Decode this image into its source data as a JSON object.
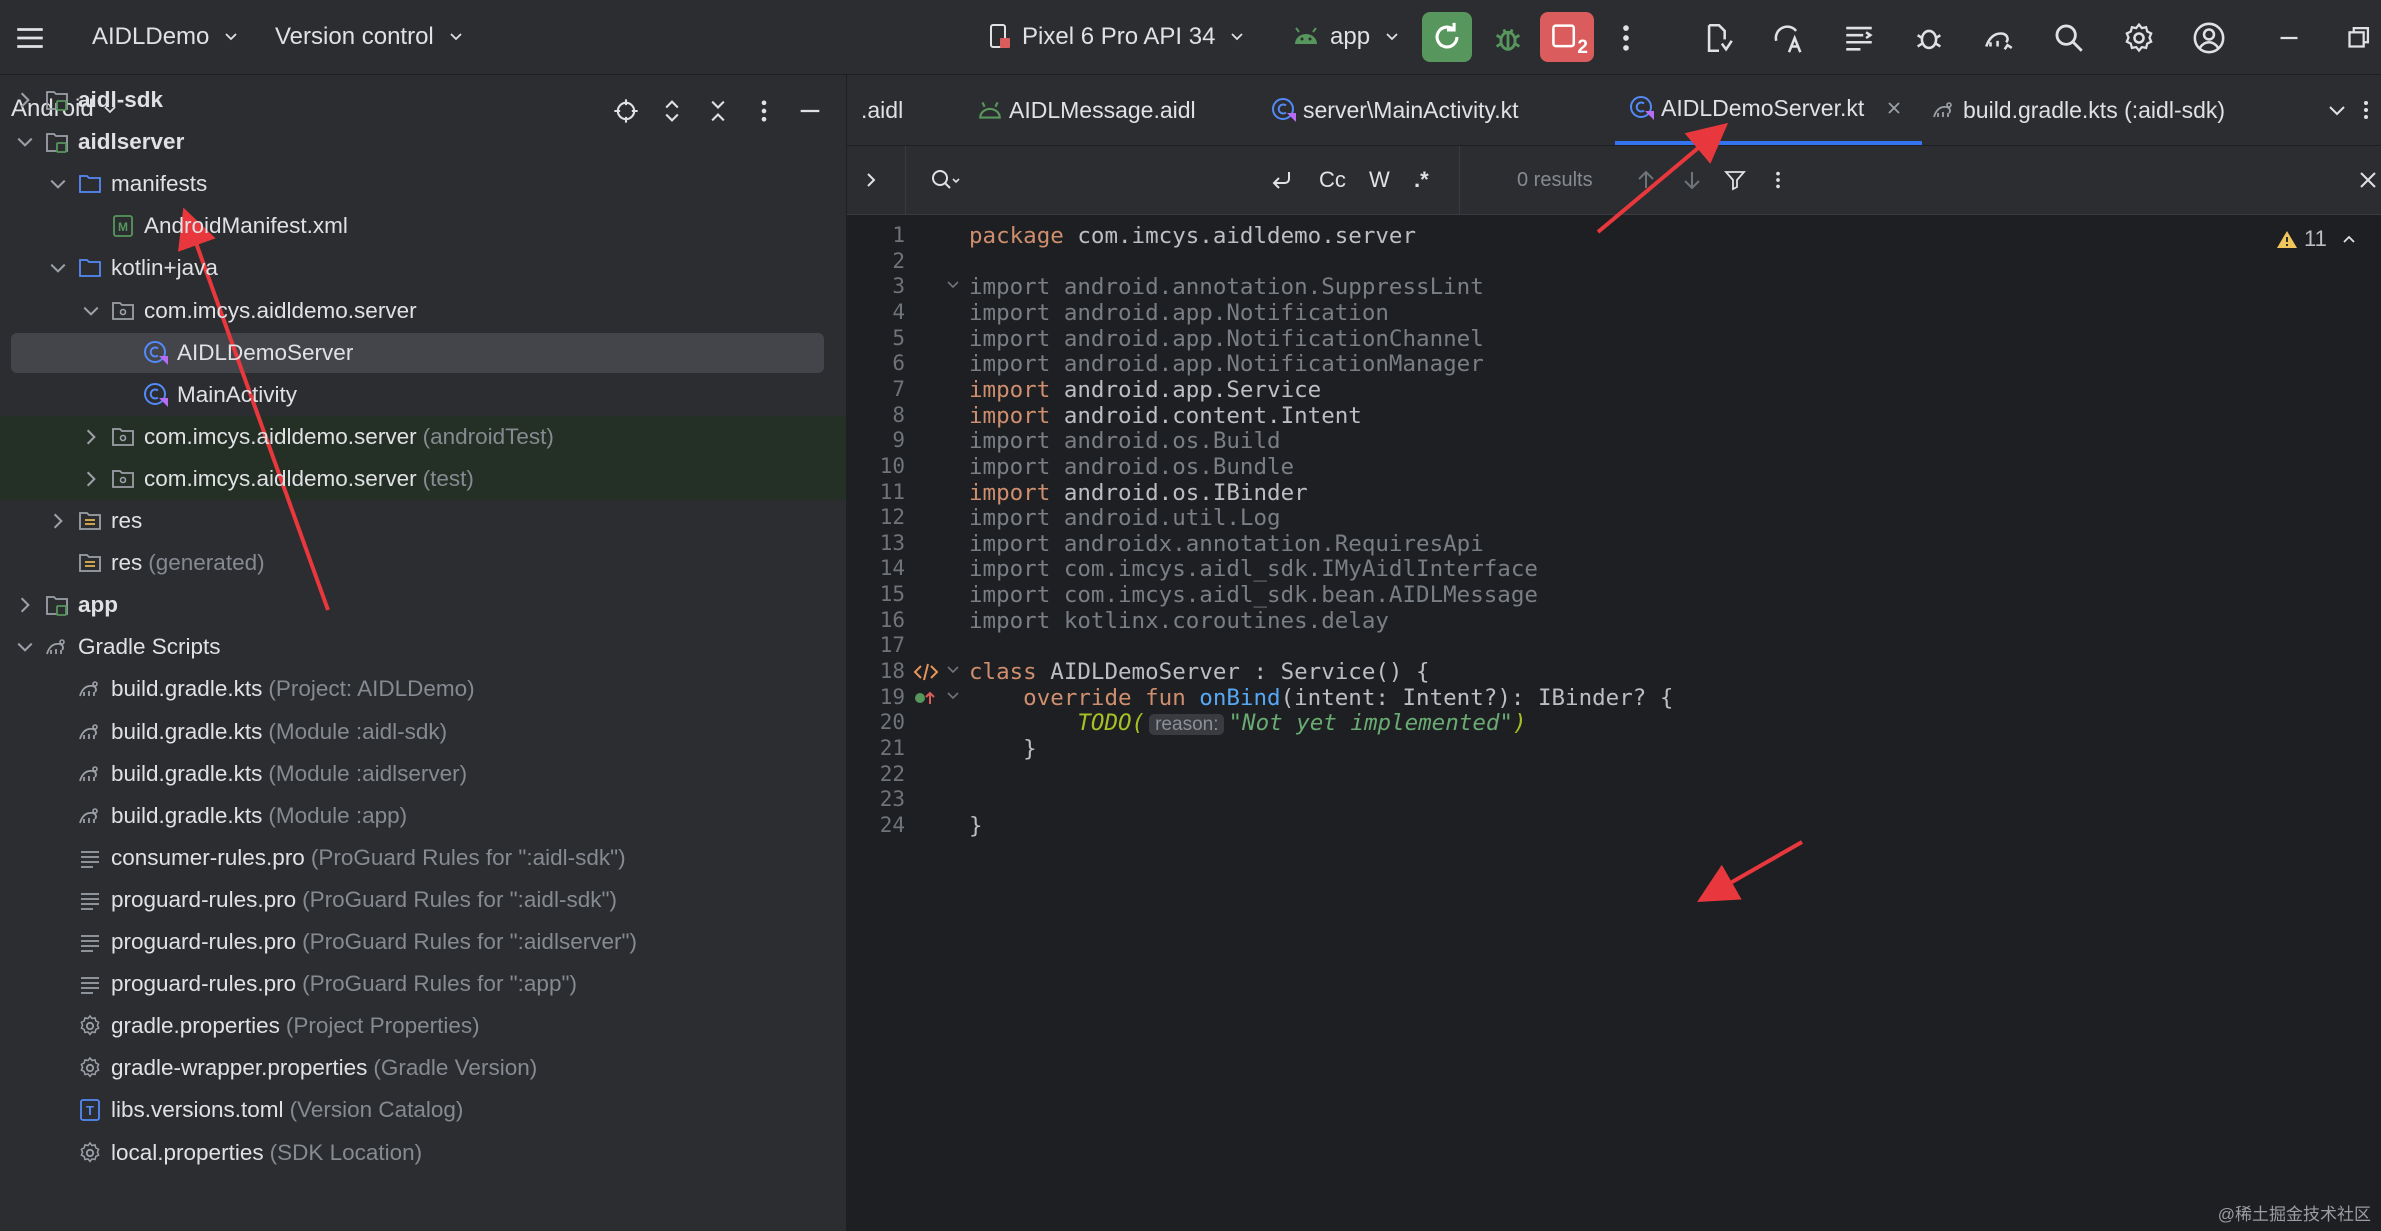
{
  "topbar": {
    "project_name": "AIDLDemo",
    "vcs_label": "Version control",
    "device": "Pixel 6 Pro API 34",
    "run_config": "app",
    "badge_count": "2"
  },
  "project_panel": {
    "title": "Android",
    "tree": [
      {
        "label": "aidl-sdk",
        "hint": "",
        "level": 0,
        "arrow": "right",
        "icon": "module-icon",
        "bold": true
      },
      {
        "label": "aidlserver",
        "hint": "",
        "level": 0,
        "arrow": "down",
        "icon": "module-icon",
        "bold": true
      },
      {
        "label": "manifests",
        "hint": "",
        "level": 1,
        "arrow": "down",
        "icon": "folder-icon"
      },
      {
        "label": "AndroidManifest.xml",
        "hint": "",
        "level": 2,
        "arrow": "none",
        "icon": "manifest-icon"
      },
      {
        "label": "kotlin+java",
        "hint": "",
        "level": 1,
        "arrow": "down",
        "icon": "folder-icon"
      },
      {
        "label": "com.imcys.aidldemo.server",
        "hint": "",
        "level": 2,
        "arrow": "down",
        "icon": "package-icon"
      },
      {
        "label": "AIDLDemoServer",
        "hint": "",
        "level": 3,
        "arrow": "none",
        "icon": "kotlin-class-icon",
        "selected": true
      },
      {
        "label": "MainActivity",
        "hint": "",
        "level": 3,
        "arrow": "none",
        "icon": "kotlin-class-icon"
      },
      {
        "label": "com.imcys.aidldemo.server",
        "hint": "(androidTest)",
        "level": 2,
        "arrow": "right",
        "icon": "package-icon",
        "highlight": true
      },
      {
        "label": "com.imcys.aidldemo.server",
        "hint": "(test)",
        "level": 2,
        "arrow": "right",
        "icon": "package-icon",
        "highlight": true
      },
      {
        "label": "res",
        "hint": "",
        "level": 1,
        "arrow": "right",
        "icon": "res-folder-icon"
      },
      {
        "label": "res",
        "hint": "(generated)",
        "level": 1,
        "arrow": "none",
        "icon": "res-folder-icon"
      },
      {
        "label": "app",
        "hint": "",
        "level": 0,
        "arrow": "right",
        "icon": "module-icon",
        "bold": true
      },
      {
        "label": "Gradle Scripts",
        "hint": "",
        "level": 0,
        "arrow": "down",
        "icon": "gradle-icon"
      },
      {
        "label": "build.gradle.kts",
        "hint": "(Project: AIDLDemo)",
        "level": 1,
        "arrow": "none",
        "icon": "gradle-icon"
      },
      {
        "label": "build.gradle.kts",
        "hint": "(Module :aidl-sdk)",
        "level": 1,
        "arrow": "none",
        "icon": "gradle-icon"
      },
      {
        "label": "build.gradle.kts",
        "hint": "(Module :aidlserver)",
        "level": 1,
        "arrow": "none",
        "icon": "gradle-icon"
      },
      {
        "label": "build.gradle.kts",
        "hint": "(Module :app)",
        "level": 1,
        "arrow": "none",
        "icon": "gradle-icon"
      },
      {
        "label": "consumer-rules.pro",
        "hint": "(ProGuard Rules for \":aidl-sdk\")",
        "level": 1,
        "arrow": "none",
        "icon": "text-file-icon"
      },
      {
        "label": "proguard-rules.pro",
        "hint": "(ProGuard Rules for \":aidl-sdk\")",
        "level": 1,
        "arrow": "none",
        "icon": "text-file-icon"
      },
      {
        "label": "proguard-rules.pro",
        "hint": "(ProGuard Rules for \":aidlserver\")",
        "level": 1,
        "arrow": "none",
        "icon": "text-file-icon"
      },
      {
        "label": "proguard-rules.pro",
        "hint": "(ProGuard Rules for \":app\")",
        "level": 1,
        "arrow": "none",
        "icon": "text-file-icon"
      },
      {
        "label": "gradle.properties",
        "hint": "(Project Properties)",
        "level": 1,
        "arrow": "none",
        "icon": "settings-file-icon"
      },
      {
        "label": "gradle-wrapper.properties",
        "hint": "(Gradle Version)",
        "level": 1,
        "arrow": "none",
        "icon": "settings-file-icon"
      },
      {
        "label": "libs.versions.toml",
        "hint": "(Version Catalog)",
        "level": 1,
        "arrow": "none",
        "icon": "toml-icon"
      },
      {
        "label": "local.properties",
        "hint": "(SDK Location)",
        "level": 1,
        "arrow": "none",
        "icon": "settings-file-icon"
      }
    ]
  },
  "tabs": [
    {
      "label": ".aidl",
      "icon": "",
      "active": false
    },
    {
      "label": "AIDLMessage.aidl",
      "icon": "aidl-file-icon",
      "active": false
    },
    {
      "label": "server\\MainActivity.kt",
      "icon": "kotlin-class-icon",
      "active": false
    },
    {
      "label": "AIDLDemoServer.kt",
      "icon": "kotlin-class-icon",
      "active": true
    },
    {
      "label": "build.gradle.kts (:aidl-sdk)",
      "icon": "gradle-icon",
      "active": false
    }
  ],
  "find": {
    "case_label": "Cc",
    "word_label": "W",
    "regex_label": ".*",
    "results": "0 results"
  },
  "editor": {
    "warning_count": "11",
    "line_numbers": [
      "1",
      "2",
      "3",
      "4",
      "5",
      "6",
      "7",
      "8",
      "9",
      "10",
      "11",
      "12",
      "13",
      "14",
      "15",
      "16",
      "17",
      "18",
      "19",
      "20",
      "21",
      "22",
      "23",
      "24"
    ],
    "lines": [
      [
        {
          "t": "package ",
          "c": "kw"
        },
        {
          "t": "com.imcys.aidldemo.server",
          "c": "white"
        }
      ],
      [],
      [
        {
          "t": "import android.annotation.SuppressLint",
          "c": "gray"
        }
      ],
      [
        {
          "t": "import android.app.Notification",
          "c": "gray"
        }
      ],
      [
        {
          "t": "import android.app.NotificationChannel",
          "c": "gray"
        }
      ],
      [
        {
          "t": "import android.app.NotificationManager",
          "c": "gray"
        }
      ],
      [
        {
          "t": "import ",
          "c": "kw"
        },
        {
          "t": "android.app.Service",
          "c": "white"
        }
      ],
      [
        {
          "t": "import ",
          "c": "kw"
        },
        {
          "t": "android.content.Intent",
          "c": "white"
        }
      ],
      [
        {
          "t": "import android.os.Build",
          "c": "gray"
        }
      ],
      [
        {
          "t": "import android.os.Bundle",
          "c": "gray"
        }
      ],
      [
        {
          "t": "import ",
          "c": "kw"
        },
        {
          "t": "android.os.IBinder",
          "c": "white"
        }
      ],
      [
        {
          "t": "import android.util.Log",
          "c": "gray"
        }
      ],
      [
        {
          "t": "import androidx.annotation.RequiresApi",
          "c": "gray"
        }
      ],
      [
        {
          "t": "import com.imcys.aidl_sdk.IMyAidlInterface",
          "c": "gray"
        }
      ],
      [
        {
          "t": "import com.imcys.aidl_sdk.bean.AIDLMessage",
          "c": "gray"
        }
      ],
      [
        {
          "t": "import kotlinx.coroutines.delay",
          "c": "gray"
        }
      ],
      [],
      [
        {
          "t": "class ",
          "c": "kw"
        },
        {
          "t": "AIDLDemoServer : Service() {",
          "c": "white"
        }
      ],
      [
        {
          "t": "    override fun ",
          "c": "kw"
        },
        {
          "t": "onBind",
          "c": "fn"
        },
        {
          "t": "(intent: Intent?): IBinder? {",
          "c": "white"
        }
      ],
      [
        {
          "t": "        TODO(",
          "c": "todo"
        },
        {
          "t": "reason:",
          "c": "inlay"
        },
        {
          "t": "\"Not yet implemented\"",
          "c": "str"
        },
        {
          "t": ")",
          "c": "todo"
        }
      ],
      [
        {
          "t": "    }",
          "c": "white"
        }
      ],
      [],
      [],
      [
        {
          "t": "}",
          "c": "white"
        }
      ]
    ]
  },
  "watermark": "@稀土掘金技术社区",
  "colors": {
    "accent": "#3574f0",
    "run_green": "#57965c",
    "stop_red": "#db5c5c",
    "annotation_arrow": "#e8383d"
  }
}
